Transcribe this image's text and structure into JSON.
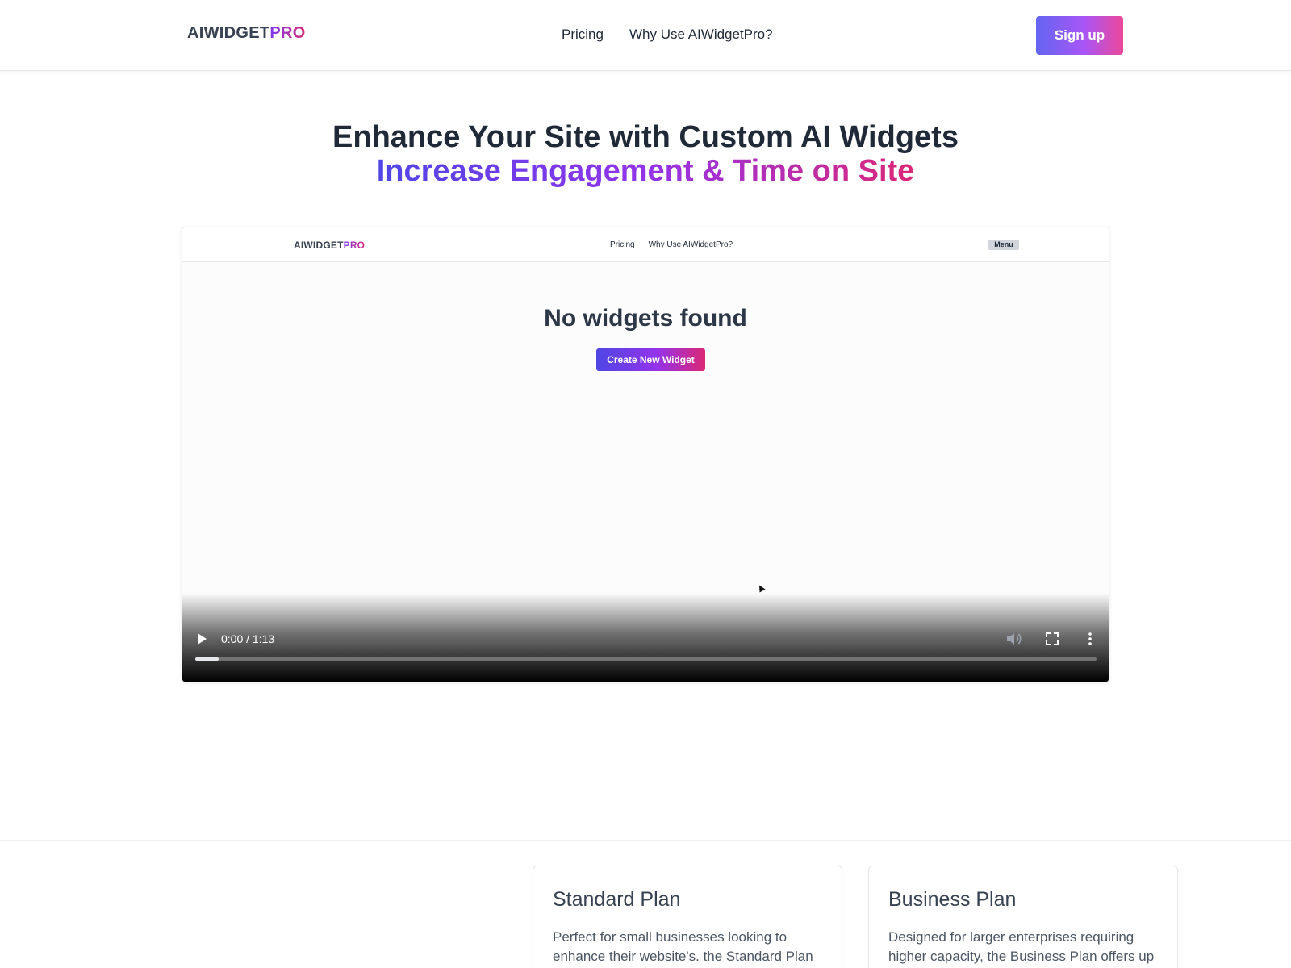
{
  "header": {
    "logo_main": "AIWIDGET",
    "logo_accent": "PRO",
    "nav": [
      "Pricing",
      "Why Use AIWidgetPro?"
    ],
    "signup_label": "Sign up"
  },
  "hero": {
    "title": "Enhance Your Site with Custom AI Widgets",
    "subtitle": "Increase Engagement & Time on Site"
  },
  "video": {
    "inner_header": {
      "logo_main": "AIWIDGET",
      "logo_accent": "PRO",
      "nav": [
        "Pricing",
        "Why Use AIWidgetPro?"
      ],
      "menu_label": "Menu"
    },
    "empty_message": "No widgets found",
    "create_label": "Create New Widget",
    "controls": {
      "time": "0:00 / 1:13",
      "progress": 0.026
    }
  },
  "plans": [
    {
      "name": "Standard Plan",
      "description": "Perfect for small businesses looking to enhance their website's. the Standard Plan"
    },
    {
      "name": "Business Plan",
      "description": "Designed for larger enterprises requiring higher capacity, the Business Plan offers up"
    }
  ],
  "colors": {
    "accent_start": "#6366f1",
    "accent_mid": "#a855f7",
    "accent_end": "#ec4899",
    "text_dark": "#1f2937"
  }
}
